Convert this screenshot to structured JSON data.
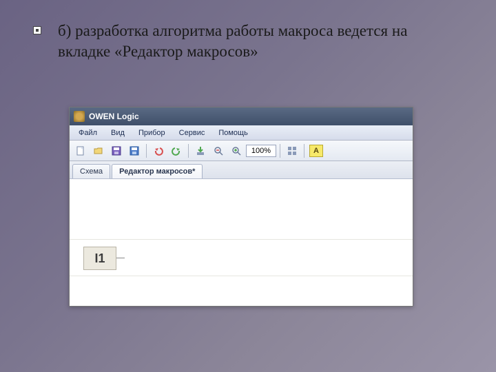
{
  "slide": {
    "bullet_text": "б) разработка алгоритма работы макроса ведется на вкладке «Редактор макросов»"
  },
  "app": {
    "title": "OWEN Logic",
    "menus": [
      "Файл",
      "Вид",
      "Прибор",
      "Сервис",
      "Помощь"
    ],
    "toolbar": {
      "icons": [
        "new-file-icon",
        "open-icon",
        "save-icon",
        "save-blue-icon",
        "sep",
        "undo-icon",
        "redo-icon",
        "sep",
        "download-icon",
        "zoom-out-icon",
        "zoom-in-icon"
      ],
      "zoom_value": "100%",
      "right_icons": [
        "grid-icon",
        "sep",
        "label-a"
      ]
    },
    "tabs": [
      {
        "label": "Схема",
        "active": false
      },
      {
        "label": "Редактор макросов*",
        "active": true
      }
    ],
    "canvas": {
      "io_label": "I1"
    }
  }
}
